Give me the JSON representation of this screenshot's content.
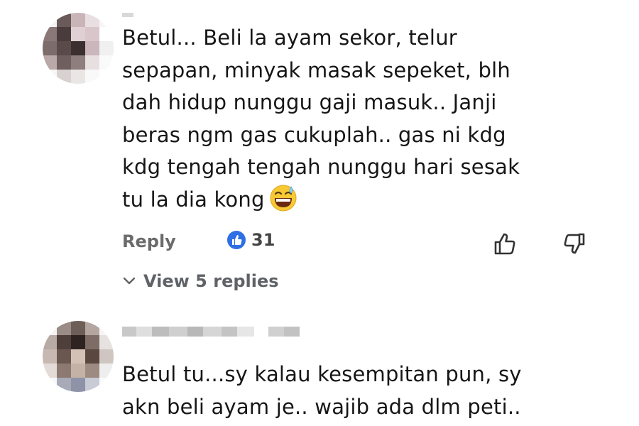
{
  "comments": [
    {
      "lines": [
        "Betul... Beli la ayam sekor, telur",
        "sepapan, minyak masak sepeket, blh",
        "dah hidup nunggu gaji masuk.. Janji",
        "beras ngm gas cukuplah.. gas ni kdg",
        "kdg tengah tengah nunggu hari sesak",
        "tu la dia kong"
      ],
      "emoji": "grinning-sweat-emoji",
      "actions": {
        "reply_label": "Reply",
        "like_count": "31",
        "view_replies_label": "View 5 replies"
      }
    },
    {
      "lines": [
        "Betul tu...sy kalau kesempitan pun, sy",
        "akn beli ayam je.. wajib ada dlm peti.."
      ]
    }
  ],
  "colors": {
    "like_badge_blue": "#2f6fe4",
    "action_gray": "#6b6b6b",
    "text": "#161616"
  },
  "icons": {
    "like_badge": "thumbs-up-filled-icon",
    "like": "thumbs-up-outline-icon",
    "dislike": "thumbs-down-outline-icon",
    "expand": "chevron-down-icon"
  }
}
